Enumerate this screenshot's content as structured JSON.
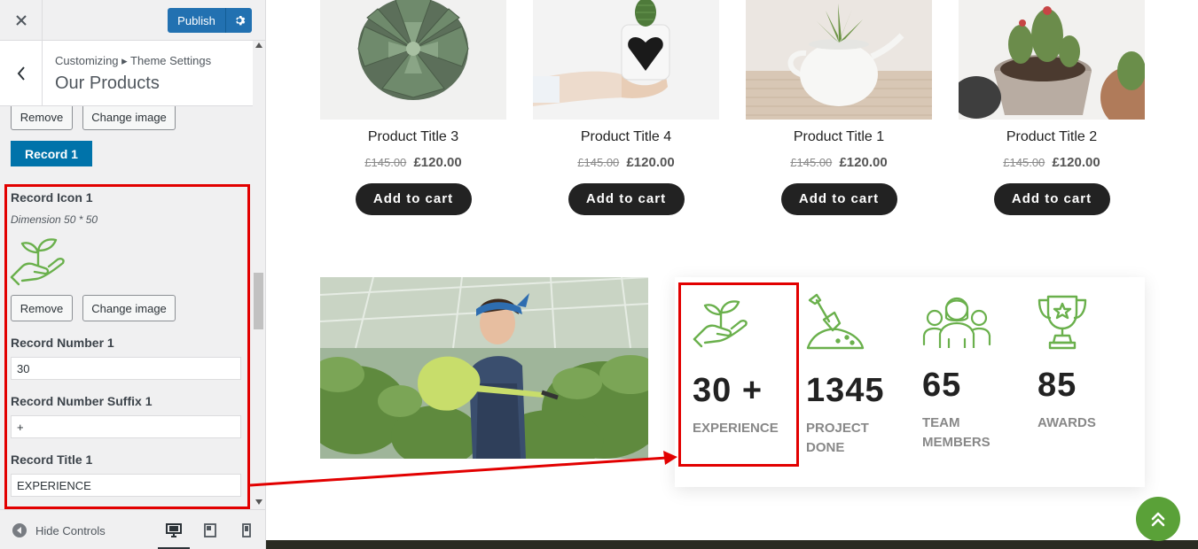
{
  "customizer": {
    "close_icon": "close-icon",
    "publish_label": "Publish",
    "gear_icon": "gear-icon",
    "breadcrumb": "Customizing ▸ Theme Settings",
    "section_title": "Our Products",
    "remove_label_top": "Remove",
    "change_image_label_top": "Change image",
    "record_tab_label": "Record 1",
    "record_icon_label": "Record Icon 1",
    "record_icon_dimension": "Dimension 50 * 50",
    "remove_label": "Remove",
    "change_image_label": "Change image",
    "record_number_label": "Record Number 1",
    "record_number_value": "30",
    "record_suffix_label": "Record Number Suffix 1",
    "record_suffix_value": "+",
    "record_title_label": "Record Title 1",
    "record_title_value": "EXPERIENCE",
    "hide_controls_label": "Hide Controls",
    "devices": [
      "desktop-icon",
      "tablet-icon",
      "mobile-icon"
    ]
  },
  "products": [
    {
      "title": "Product Title 3",
      "old_price": "£145.00",
      "new_price": "£120.00",
      "button": "Add to cart",
      "image": "succulent-top-view"
    },
    {
      "title": "Product Title 4",
      "old_price": "£145.00",
      "new_price": "£120.00",
      "button": "Add to cart",
      "image": "hand-holding-cactus-pot"
    },
    {
      "title": "Product Title 1",
      "old_price": "£145.00",
      "new_price": "£120.00",
      "button": "Add to cart",
      "image": "teapot-planter"
    },
    {
      "title": "Product Title 2",
      "old_price": "£145.00",
      "new_price": "£120.00",
      "button": "Add to cart",
      "image": "potted-cacti"
    }
  ],
  "stats": [
    {
      "number": "30",
      "suffix": "+",
      "label": "EXPERIENCE",
      "icon": "plant-in-hand-icon"
    },
    {
      "number": "1345",
      "suffix": "",
      "label": "PROJECT DONE",
      "icon": "shovel-icon"
    },
    {
      "number": "65",
      "suffix": "",
      "label": "TEAM MEMBERS",
      "icon": "team-icon"
    },
    {
      "number": "85",
      "suffix": "",
      "label": "AWARDS",
      "icon": "trophy-icon"
    }
  ],
  "colors": {
    "accent_blue": "#2271b1",
    "record_tab": "#0073aa",
    "highlight_red": "#e20000",
    "icon_green": "#6ab04c",
    "scroll_top_green": "#5aa138"
  }
}
